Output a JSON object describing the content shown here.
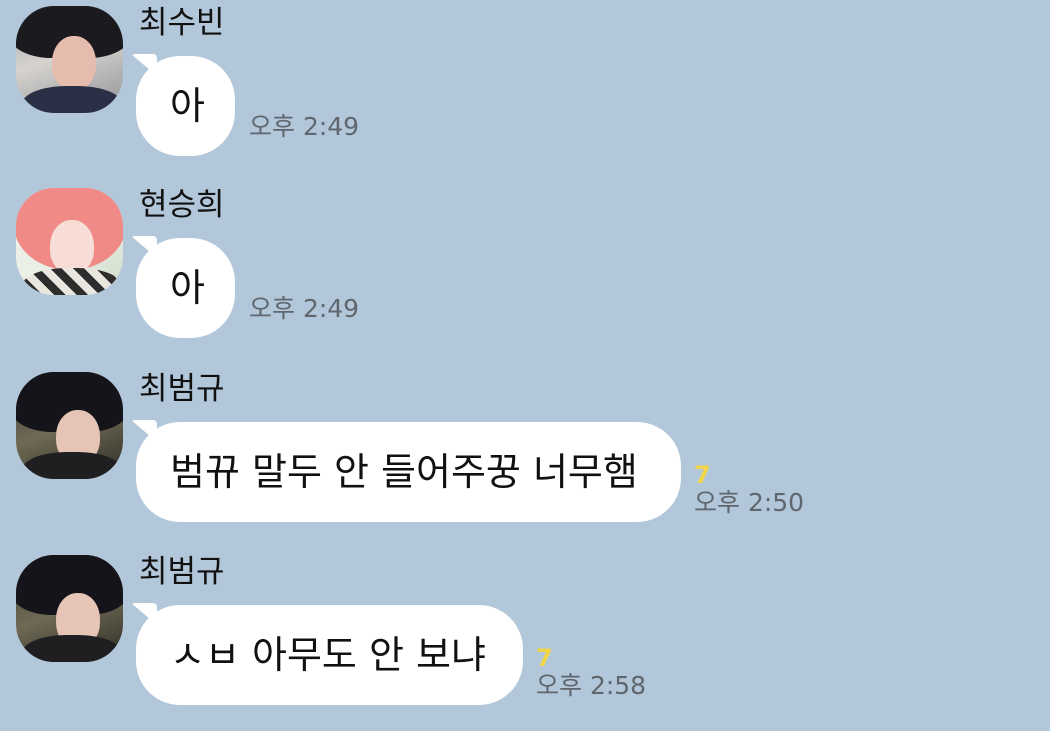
{
  "messages": [
    {
      "sender": "최수빈",
      "avatar_icon": "profile-photo-icon",
      "text": "아",
      "unread": "",
      "time": "오후 2:49"
    },
    {
      "sender": "현승희",
      "avatar_icon": "profile-photo-icon",
      "text": "아",
      "unread": "",
      "time": "오후 2:49"
    },
    {
      "sender": "최범규",
      "avatar_icon": "profile-photo-icon",
      "text": "범뀨 말두 안 들어주꿍 너무햄",
      "unread": "7",
      "time": "오후 2:50"
    },
    {
      "sender": "최범규",
      "avatar_icon": "profile-photo-icon",
      "text": "ㅅㅂ 아무도 안 보냐",
      "unread": "7",
      "time": "오후 2:58"
    }
  ],
  "colors": {
    "background": "#b2c7d9",
    "bubble": "#ffffff",
    "unread_count": "#f2d648",
    "time": "#5f666e"
  }
}
